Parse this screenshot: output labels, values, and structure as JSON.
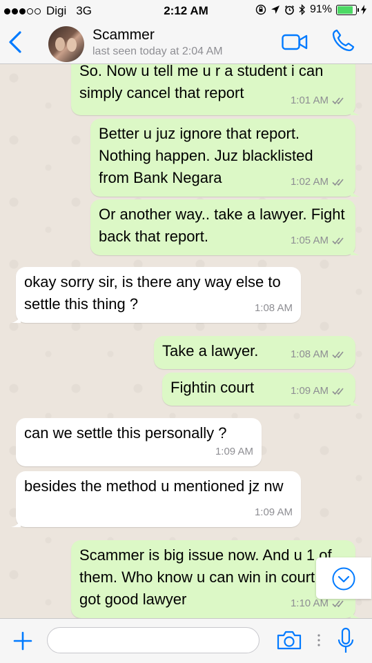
{
  "status_bar": {
    "carrier": "Digi",
    "network": "3G",
    "time": "2:12 AM",
    "battery": "91%",
    "battery_level": 0.91
  },
  "header": {
    "back_icon": "chevron-left-icon",
    "contact_name": "Scammer",
    "last_seen": "last seen today at 2:04 AM",
    "video_icon": "video-call-icon",
    "call_icon": "phone-icon"
  },
  "colors": {
    "accent": "#007aff",
    "outgoing_bubble": "#dcf8c6",
    "incoming_bubble": "#ffffff",
    "chat_background": "#ece5dd",
    "read_ticks": "#8e8e93"
  },
  "messages": [
    {
      "direction": "out",
      "text": "So. Now u tell me u r a student i can simply cancel that report",
      "time": "1:01 AM",
      "read": true
    },
    {
      "direction": "out",
      "text": "Better u juz ignore that report. Nothing happen. Juz blacklisted from Bank Negara",
      "time": "1:02 AM",
      "read": true
    },
    {
      "direction": "out",
      "text": "Or another way.. take a lawyer. Fight back that report.",
      "time": "1:05 AM",
      "read": true
    },
    {
      "direction": "in",
      "text": "okay sorry sir, is there any way else to settle this thing ?",
      "time": "1:08 AM"
    },
    {
      "direction": "out",
      "text": "Take a lawyer.",
      "time": "1:08 AM",
      "read": true
    },
    {
      "direction": "out",
      "text": "Fightin court",
      "time": "1:09 AM",
      "read": true
    },
    {
      "direction": "in",
      "text": "can we settle this personally ?",
      "time": "1:09 AM"
    },
    {
      "direction": "in",
      "text": "besides the method u mentioned jz nw",
      "time": "1:09 AM"
    },
    {
      "direction": "out",
      "text": "Scammer is big issue now. And u 1 of them. Who know u can win in court if got good lawyer",
      "time": "1:10 AM",
      "read": true
    }
  ],
  "scroll_button_icon": "chevron-down-circle-icon",
  "input_bar": {
    "attach_icon": "plus-icon",
    "placeholder": "",
    "camera_icon": "camera-icon",
    "mic_icon": "microphone-icon"
  }
}
